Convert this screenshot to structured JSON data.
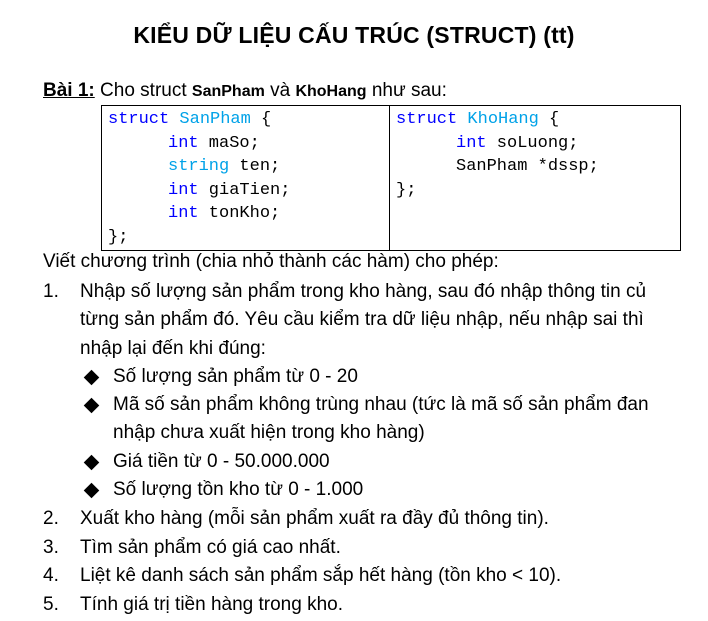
{
  "title": "KIỂU DỮ LIỆU CẤU TRÚC (STRUCT) (tt)",
  "intro": {
    "bai": "Bài 1:",
    "text1": " Cho struct ",
    "struct1": "SanPham",
    "text2": " và ",
    "struct2": "KhoHang",
    "text3": " như sau:"
  },
  "code": {
    "sanpham": {
      "struct_kw": "struct",
      "name": "SanPham",
      "open": " {",
      "fields": [
        {
          "type": "int",
          "name": " maSo;"
        },
        {
          "type": "string",
          "name": " ten;"
        },
        {
          "type": "int",
          "name": " giaTien;"
        },
        {
          "type": "int",
          "name": " tonKho;"
        }
      ],
      "close": "};"
    },
    "khohang": {
      "struct_kw": "struct",
      "name": "KhoHang",
      "open": " {",
      "field1_type": "int",
      "field1_name": " soLuong;",
      "field2": "SanPham *dssp;",
      "close": "};"
    }
  },
  "task_intro": "Viết chương trình (chia nhỏ thành các hàm) cho phép:",
  "items": [
    {
      "num": "1.",
      "lines": [
        "Nhập số lượng sản phẩm trong kho hàng, sau đó nhập thông tin củ",
        "từng sản phẩm đó. Yêu cầu kiểm tra dữ liệu nhập, nếu nhập sai thì",
        "nhập lại đến khi đúng:"
      ],
      "bullets": [
        [
          "Số lượng sản phẩm từ 0 - 20"
        ],
        [
          "Mã số sản phẩm không trùng nhau (tức là mã số sản phẩm đan",
          "nhập chưa xuất hiện trong kho hàng)"
        ],
        [
          "Giá tiền từ 0 - 50.000.000"
        ],
        [
          "Số lượng tồn kho từ 0 - 1.000"
        ]
      ]
    },
    {
      "num": "2.",
      "lines": [
        "Xuất kho hàng (mỗi sản phẩm xuất ra đầy đủ thông tin)."
      ]
    },
    {
      "num": "3.",
      "lines": [
        "Tìm sản phẩm có giá cao nhất."
      ]
    },
    {
      "num": "4.",
      "lines": [
        "Liệt kê danh sách sản phẩm sắp hết hàng (tồn kho < 10)."
      ]
    },
    {
      "num": "5.",
      "lines": [
        "Tính giá trị tiền hàng trong kho."
      ]
    }
  ],
  "colors": {
    "keyword": "#0000ff",
    "type_name": "#00a2e8"
  }
}
